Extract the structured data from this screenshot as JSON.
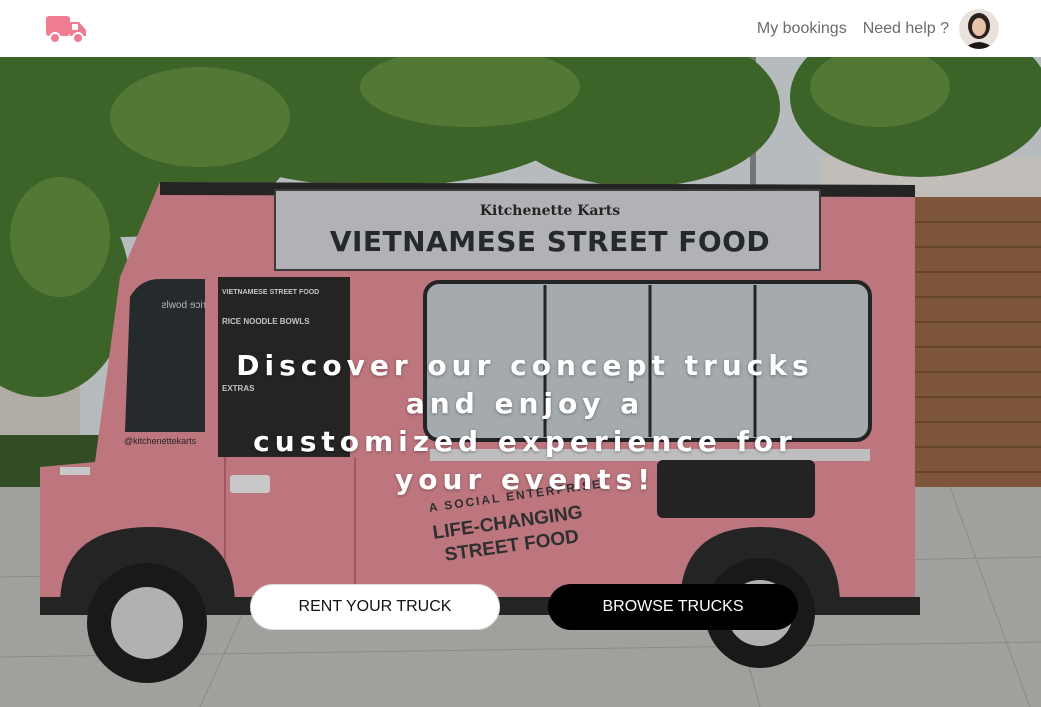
{
  "nav": {
    "my_bookings": "My bookings",
    "need_help": "Need help ?"
  },
  "hero": {
    "headline_line1": "Discover our concept trucks and enjoy a",
    "headline_line2": "customized experience for your events!",
    "truck_brand": "Kitchenette Karts",
    "truck_title": "VIETNAMESE STREET FOOD",
    "truck_tagline_1": "A SOCIAL ENTERPRISE",
    "truck_tagline_2": "LIFE-CHANGING",
    "truck_tagline_3": "STREET FOOD",
    "menu_title": "VIETNAMESE STREET FOOD",
    "menu_section_1": "RICE NOODLE BOWLS",
    "menu_section_2": "EXTRAS",
    "truck_handle": "@kitchenettekarts",
    "window_sign": "rice bowls"
  },
  "buttons": {
    "rent": "RENT YOUR TRUCK",
    "browse": "BROWSE TRUCKS"
  },
  "colors": {
    "accent_pink": "#f27c8f",
    "truck_pink": "#e8909a",
    "button_dark": "#000000"
  }
}
